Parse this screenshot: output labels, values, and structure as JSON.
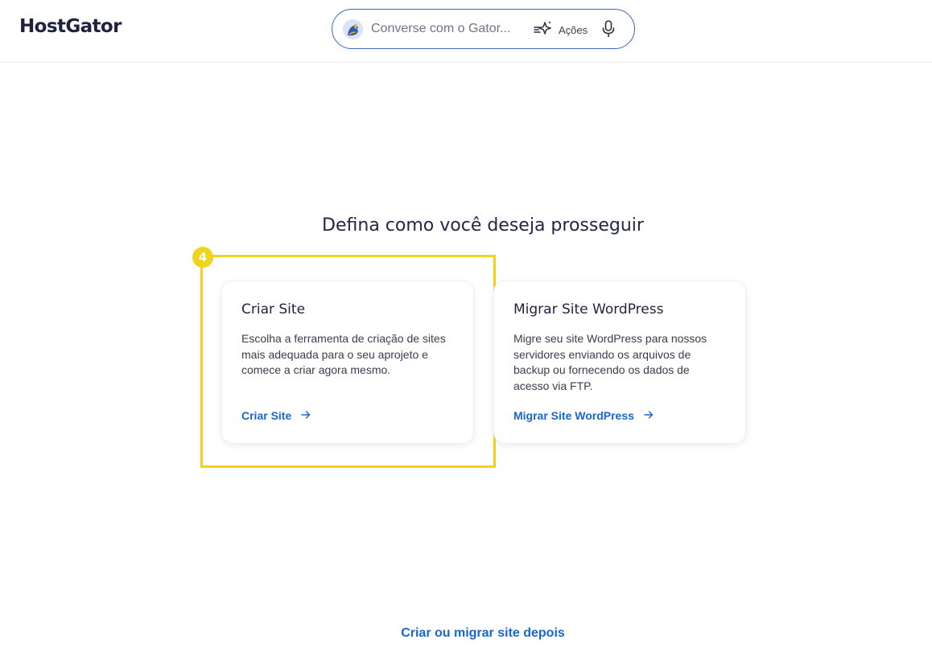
{
  "header": {
    "logo": "HostGator",
    "chat": {
      "placeholder": "Converse com o Gator...",
      "actions_label": "Ações"
    }
  },
  "main": {
    "title": "Defina como você deseja prosseguir",
    "step_badge": "4",
    "cards": [
      {
        "title": "Criar Site",
        "description": "Escolha a ferramenta de criação de sites mais adequada para o seu aprojeto e comece a criar agora mesmo.",
        "link": "Criar Site"
      },
      {
        "title": "Migrar Site WordPress",
        "description": "Migre seu site WordPress para nossos servidores enviando os arquivos de backup ou fornecendo os dados de acesso via FTP.",
        "link": "Migrar Site WordPress"
      }
    ],
    "later_link": "Criar ou migrar site depois"
  },
  "colors": {
    "brand_text": "#1f2140",
    "link": "#1b66c9",
    "highlight": "#f2d21b",
    "chat_border": "#3a66c9"
  },
  "icons": [
    "gator-avatar-icon",
    "sparkle-actions-icon",
    "microphone-icon",
    "arrow-right-icon"
  ]
}
